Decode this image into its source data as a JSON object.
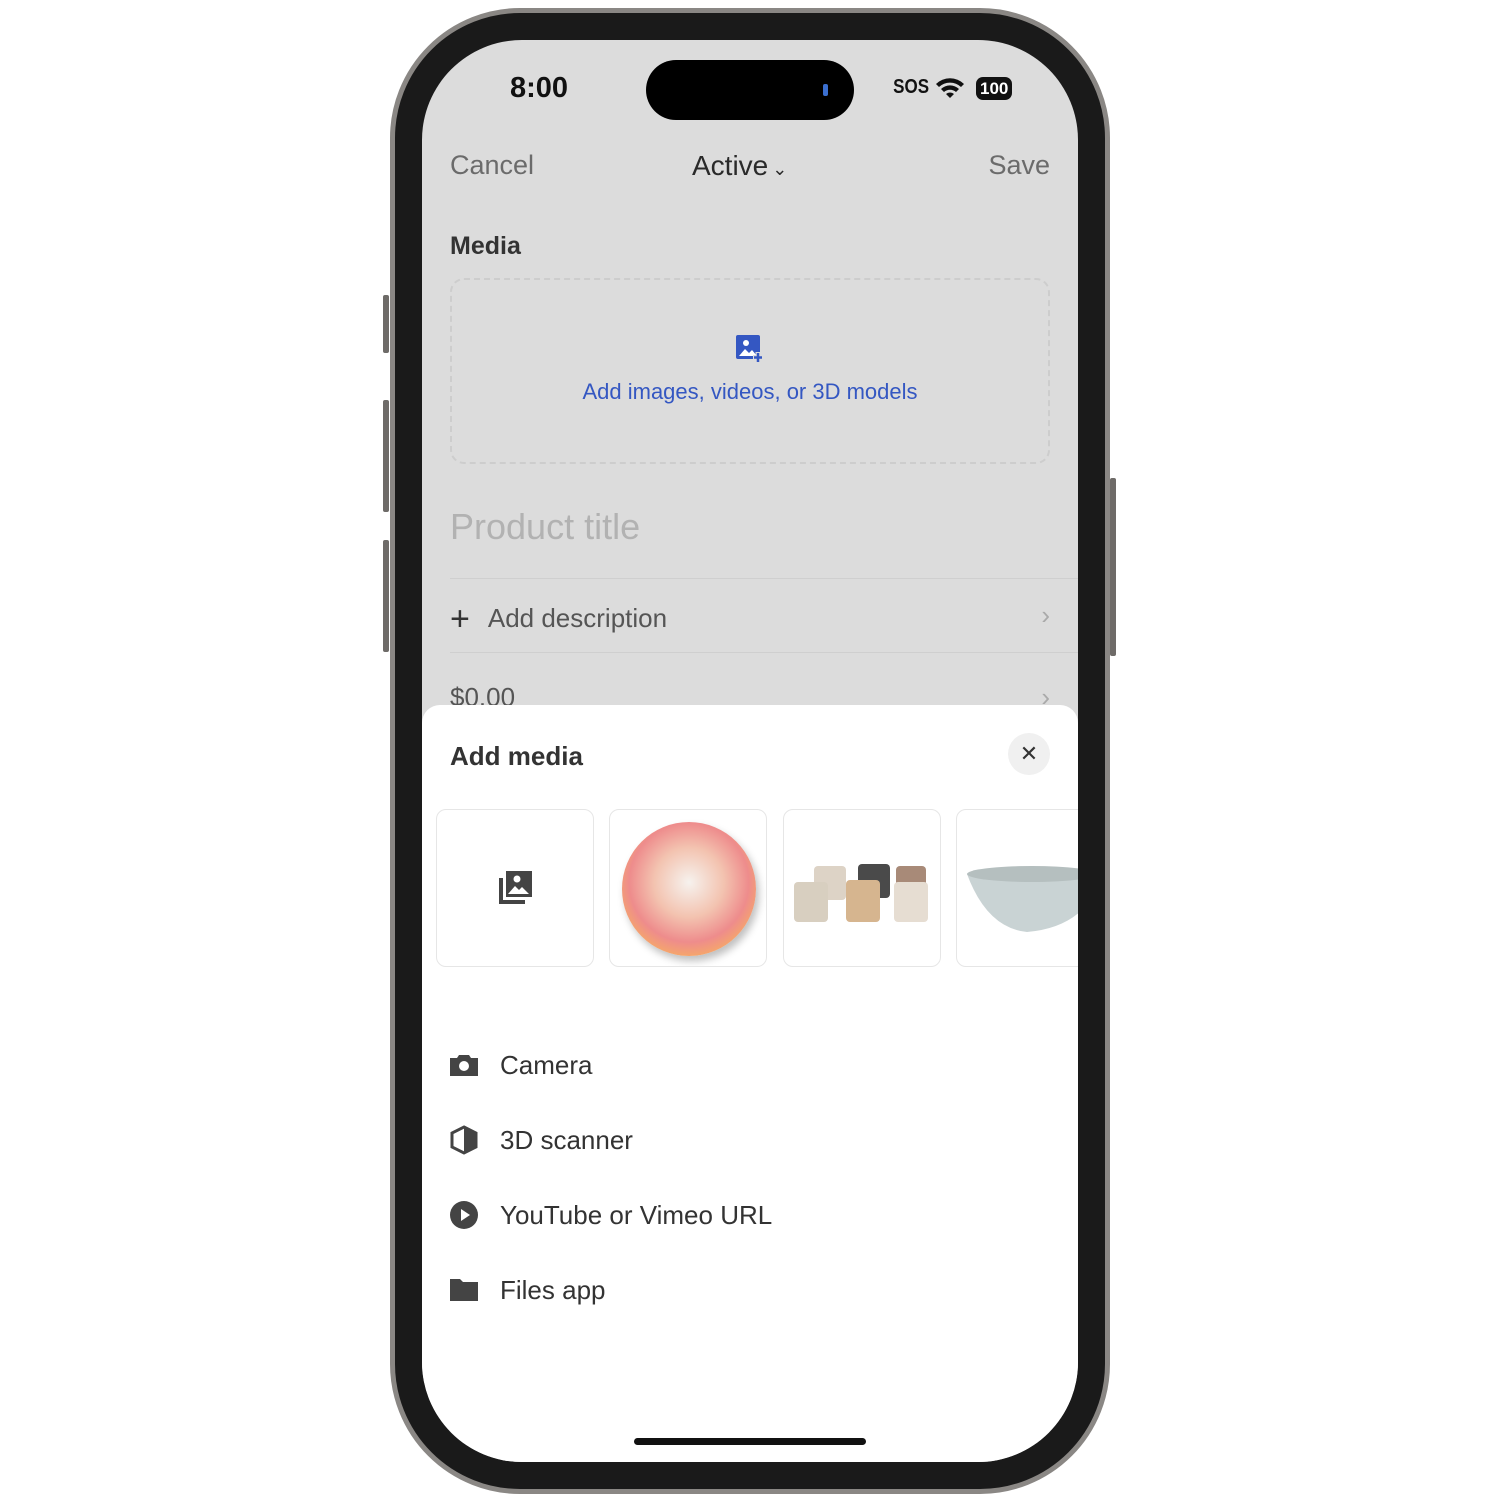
{
  "status_bar": {
    "time": "8:00",
    "sos": "SOS",
    "battery": "100"
  },
  "header": {
    "cancel": "Cancel",
    "status": "Active",
    "save": "Save"
  },
  "form": {
    "media_label": "Media",
    "add_media_prompt": "Add images, videos, or 3D models",
    "title_placeholder": "Product title",
    "add_description": "Add description",
    "price": "$0.00"
  },
  "sheet": {
    "title": "Add media",
    "thumbnails": [
      "gallery-icon",
      "plate",
      "mugs",
      "bowl"
    ],
    "options": [
      {
        "label": "Camera",
        "icon": "camera-icon"
      },
      {
        "label": "3D scanner",
        "icon": "cube-icon"
      },
      {
        "label": "YouTube or Vimeo URL",
        "icon": "play-icon"
      },
      {
        "label": "Files app",
        "icon": "folder-icon"
      }
    ]
  },
  "colors": {
    "accent": "#3457c2",
    "background": "#dcdcdc"
  }
}
